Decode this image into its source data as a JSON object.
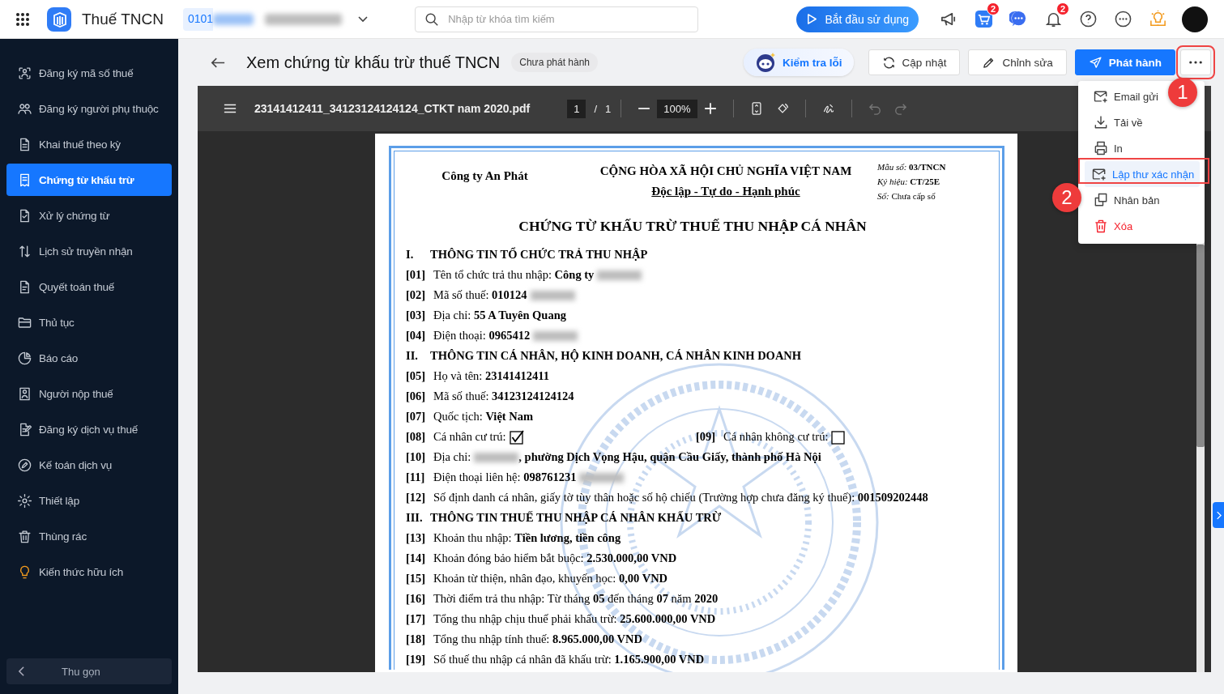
{
  "topbar": {
    "app_title": "Thuế TNCN",
    "company_code": "0101",
    "search": {
      "placeholder": "Nhập từ khóa tìm kiếm"
    },
    "start_button": "Bắt đầu sử dụng",
    "cart_badge": "2",
    "notification_badge": "2"
  },
  "sidebar": {
    "items": [
      {
        "label": "Đăng ký mã số thuế",
        "selected": false
      },
      {
        "label": "Đăng ký người phụ thuộc",
        "selected": false
      },
      {
        "label": "Khai thuế theo kỳ",
        "selected": false
      },
      {
        "label": "Chứng từ khấu trừ",
        "selected": true
      },
      {
        "label": "Xử lý chứng từ",
        "selected": false
      },
      {
        "label": "Lịch sử truyền nhận",
        "selected": false
      },
      {
        "label": "Quyết toán thuế",
        "selected": false
      },
      {
        "label": "Thủ tục",
        "selected": false
      },
      {
        "label": "Báo cáo",
        "selected": false
      },
      {
        "label": "Người nộp thuế",
        "selected": false
      },
      {
        "label": "Đăng ký dịch vụ thuế",
        "selected": false
      },
      {
        "label": "Kế toán dịch vụ",
        "selected": false
      },
      {
        "label": "Thiết lập",
        "selected": false
      },
      {
        "label": "Thùng rác",
        "selected": false
      },
      {
        "label": "Kiến thức hữu ích",
        "selected": false
      }
    ],
    "collapse_button": "Thu gọn"
  },
  "page_header": {
    "title": "Xem chứng từ khấu trừ thuế TNCN",
    "status": "Chưa phát hành",
    "check_button": "Kiểm tra lỗi",
    "buttons": [
      {
        "label": "Cập nhật",
        "kind": "default"
      },
      {
        "label": "Chỉnh sửa",
        "kind": "default"
      },
      {
        "label": "Phát hành",
        "kind": "primary"
      }
    ]
  },
  "more_menu": {
    "items": [
      {
        "label": "Email gửi",
        "kind": "normal",
        "selected": false
      },
      {
        "label": "Tải về",
        "kind": "normal",
        "selected": false
      },
      {
        "label": "In",
        "kind": "normal",
        "selected": false
      },
      {
        "label": "Lập thư xác nhận",
        "kind": "normal",
        "selected": true
      },
      {
        "label": "Nhân bản",
        "kind": "normal",
        "selected": false
      },
      {
        "label": "Xóa",
        "kind": "danger",
        "selected": false
      }
    ]
  },
  "annotations": [
    {
      "label": "1"
    },
    {
      "label": "2"
    }
  ],
  "pdf_viewer": {
    "file_name": "23141412411_34123124124124_CTKT nam 2020.pdf",
    "page_input": "1",
    "page_separator": "/",
    "page_total": "1",
    "zoom": "100%"
  },
  "document": {
    "company": "Công ty An Phát",
    "national_title": "CỘNG HÒA XÃ HỘI CHỦ NGHĨA VIỆT NAM",
    "motto": "Độc lập - Tự do - Hạnh phúc",
    "meta": [
      "*Mẫu số:* **03/TNCN**",
      "*Ký hiệu:* **CT/25E**",
      "*Số:* Chưa cấp số"
    ],
    "title": "CHỨNG TỪ KHẤU TRỪ THUẾ THU NHẬP CÁ NHÂN",
    "lines": [
      {
        "kind": "section",
        "code": "I.",
        "text": "THÔNG TIN TỔ CHỨC TRẢ THU NHẬP"
      },
      {
        "kind": "field",
        "code": "[01]",
        "text": "Tên tổ chức trả thu nhập: **Công ty**",
        "redacted": true
      },
      {
        "kind": "field",
        "code": "[02]",
        "text": "Mã số thuế: **010124**",
        "redacted": true
      },
      {
        "kind": "field",
        "code": "[03]",
        "text": "Địa chỉ: **55 A Tuyên Quang**",
        "redacted": false
      },
      {
        "kind": "field",
        "code": "[04]",
        "text": "Điện thoại: **0965412**",
        "redacted": true
      },
      {
        "kind": "section",
        "code": "II.",
        "text": "THÔNG TIN CÁ NHÂN, HỘ KINH DOANH, CÁ NHÂN KINH DOANH"
      },
      {
        "kind": "field",
        "code": "[05]",
        "text": "Họ và tên: **23141412411**",
        "redacted": false
      },
      {
        "kind": "field",
        "code": "[06]",
        "text": "Mã số thuế: **34123124124124**",
        "redacted": false
      },
      {
        "kind": "field",
        "code": "[07]",
        "text": "Quốc tịch: **Việt Nam**",
        "redacted": false
      },
      {
        "kind": "checks",
        "items": [
          {
            "code": "[08]",
            "text": "Cá nhân cư trú:",
            "checked": true
          },
          {
            "code": "[09]",
            "text": "Cá nhân không cư trú:",
            "checked": false
          }
        ]
      },
      {
        "kind": "field",
        "code": "[10]",
        "text": "Địa chỉ:",
        "redacted": true,
        "text_after": "**, phường Dịch Vọng Hậu, quận Cầu Giấy, thành phố Hà Nội**"
      },
      {
        "kind": "field",
        "code": "[11]",
        "text": "Điện thoại liên hệ: **098761231**",
        "redacted": true
      },
      {
        "kind": "field",
        "code": "[12]",
        "text": "Số định danh cá nhân, giấy tờ tùy thân hoặc số hộ chiếu (Trường hợp chưa đăng ký thuế): **001509202448**",
        "redacted": false
      },
      {
        "kind": "section",
        "code": "III.",
        "text": "THÔNG TIN THUẾ THU NHẬP CÁ NHÂN KHẤU TRỪ"
      },
      {
        "kind": "field",
        "code": "[13]",
        "text": "Khoản thu nhập: **Tiền lương, tiền công**",
        "redacted": false
      },
      {
        "kind": "field",
        "code": "[14]",
        "text": "Khoản đóng bảo hiểm bắt buộc: **2.530.000,00 VND**",
        "redacted": false
      },
      {
        "kind": "field",
        "code": "[15]",
        "text": "Khoản từ thiện, nhân đạo, khuyến học: **0,00 VND**",
        "redacted": false
      },
      {
        "kind": "field",
        "code": "[16]",
        "text": "Thời điểm trả thu nhập: Từ tháng **05**  đến tháng **07**  năm **2020**",
        "redacted": false
      },
      {
        "kind": "field",
        "code": "[17]",
        "text": "Tổng thu nhập chịu thuế phải khấu trừ: **25.600.000,00 VND**",
        "redacted": false
      },
      {
        "kind": "field",
        "code": "[18]",
        "text": "Tổng thu nhập tính thuế: **8.965.000,00 VND**",
        "redacted": false
      },
      {
        "kind": "field",
        "code": "[19]",
        "text": "Số thuế thu nhập cá nhân đã khấu trừ: **1.165.900,00 VND**",
        "redacted": false
      }
    ]
  }
}
